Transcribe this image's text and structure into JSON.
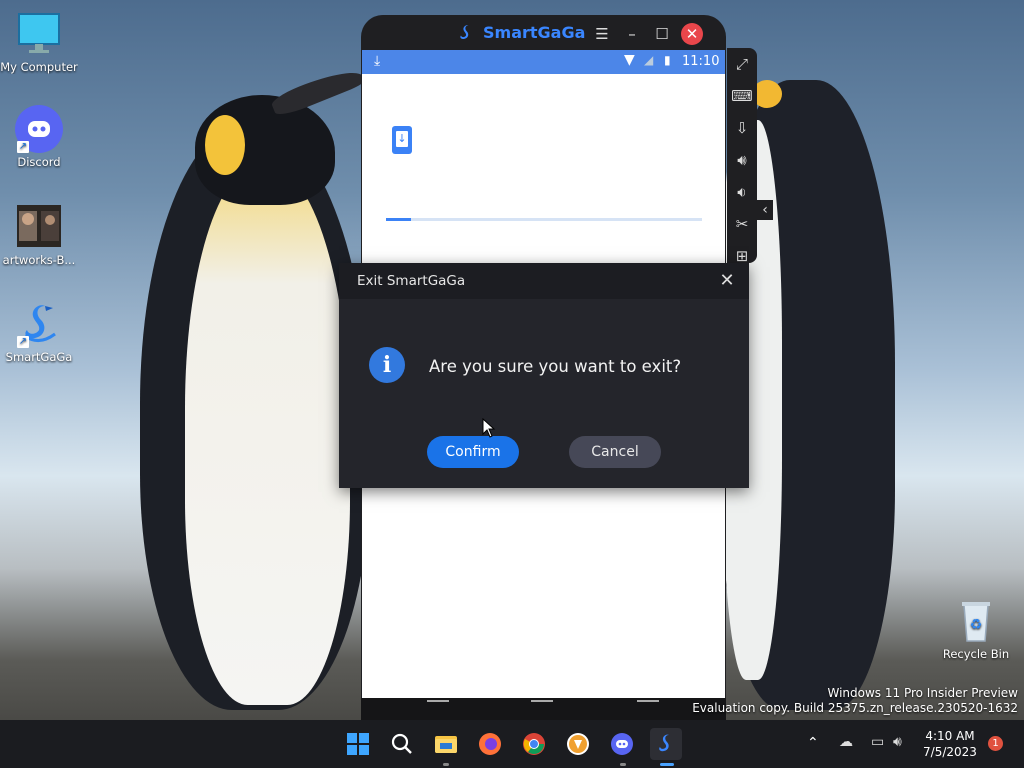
{
  "desktop": {
    "icons": [
      {
        "label": "My Computer"
      },
      {
        "label": "Discord"
      },
      {
        "label": "artworks-B..."
      },
      {
        "label": "SmartGaGa"
      },
      {
        "label": "Recycle Bin"
      }
    ],
    "watermark_line1": "Windows 11 Pro Insider Preview",
    "watermark_line2": "Evaluation copy. Build 25375.zn_release.230520-1632"
  },
  "emulator": {
    "brand": "SmartGaGa",
    "status_time": "11:10",
    "download_progress": 0.08,
    "sidebar_icons": [
      "fullscreen-icon",
      "keyboard-icon",
      "install-apk-icon",
      "volume-up-icon",
      "volume-down-icon",
      "screenshot-scissors-icon",
      "more-icon"
    ]
  },
  "dialog": {
    "title": "Exit SmartGaGa",
    "message": "Are you sure you want to exit?",
    "confirm_label": "Confirm",
    "cancel_label": "Cancel"
  },
  "taskbar": {
    "apps": [
      "start-icon",
      "search-icon",
      "file-explorer-icon",
      "firefox-icon",
      "chrome-icon",
      "brave-icon",
      "discord-icon",
      "smartgaga-icon"
    ],
    "time": "4:10 AM",
    "date": "7/5/2023",
    "notification_count": "1"
  },
  "colors": {
    "accent": "#1a73e8",
    "dialog_bg": "#24252b",
    "taskbar_bg": "#1b1c20"
  }
}
